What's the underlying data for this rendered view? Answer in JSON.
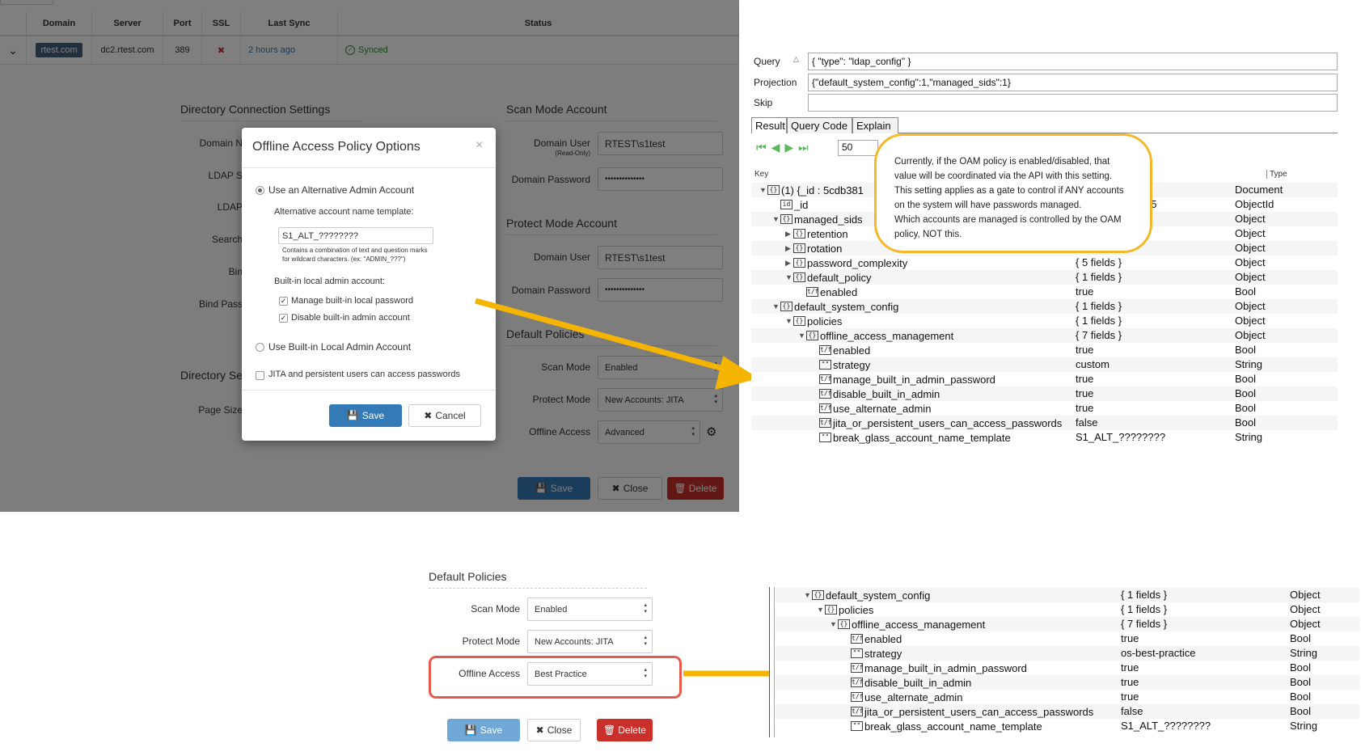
{
  "top_table": {
    "headers": [
      "Domain",
      "Server",
      "Port",
      "SSL",
      "Last Sync",
      "Status"
    ],
    "row": {
      "domain": "rtest.com",
      "server": "dc2.rtest.com",
      "port": "389",
      "ssl": "✖",
      "last_sync": "2 hours ago",
      "status": "Synced"
    }
  },
  "settings": {
    "dir_conn_title": "Directory Connection Settings",
    "scan_mode_title": "Scan Mode Account",
    "protect_mode_title": "Protect Mode Account",
    "default_policies_title": "Default Policies",
    "dir_se_title": "Directory Se",
    "left_labels": [
      "Domain N",
      "LDAP S",
      "LDAP",
      "Search",
      "Bin",
      "Bind Pass"
    ],
    "page_size_label": "Page Size",
    "domain_user_label": "Domain User",
    "read_only_label": "(Read-Only)",
    "domain_password_label": "Domain Password",
    "scan_user": "RTEST\\s1test",
    "password_mask": "••••••••••••••",
    "protect_user": "RTEST\\s1test",
    "scan_mode_label": "Scan Mode",
    "scan_mode_value": "Enabled",
    "protect_mode_label": "Protect Mode",
    "protect_mode_value": "New Accounts: JITA",
    "offline_access_label": "Offline Access",
    "offline_access_value": "Advanced",
    "save": "Save",
    "close": "Close",
    "delete": "Delete"
  },
  "modal": {
    "title": "Offline Access Policy Options",
    "close": "×",
    "opt_alt": "Use an Alternative Admin Account",
    "template_label": "Alternative account name template:",
    "template_value": "S1_ALT_????????",
    "help1": "Contains a combination of text and question marks",
    "help2": "for wildcard characters. (ex: \"ADMIN_???\")",
    "builtin_label": "Built-in local admin account:",
    "manage_pw": "Manage built-in local password",
    "disable_admin": "Disable built-in admin account",
    "opt_builtin": "Use Built-in Local Admin Account",
    "jita": "JITA and persistent users can access passwords",
    "save": "Save",
    "cancel": "Cancel"
  },
  "mongo": {
    "query_label": "Query",
    "query_value": "{ \"type\": \"ldap_config\" }",
    "projection_label": "Projection",
    "projection_value": "{\"default_system_config\":1,\"managed_sids\":1}",
    "skip_label": "Skip",
    "tabs": [
      "Result",
      "Query Code",
      "Explain"
    ],
    "page_size": "50",
    "col_key": "Key",
    "col_type": "Type",
    "rows": [
      {
        "indent": 0,
        "tri": "▼",
        "icon": "{}",
        "key": "(1) {_id : 5cdb381",
        "value": "",
        "type": "Document"
      },
      {
        "indent": 1,
        "tri": "",
        "icon": "id",
        "key": "_id",
        "value": "f71f800583c2135",
        "type": "ObjectId"
      },
      {
        "indent": 1,
        "tri": "▼",
        "icon": "{}",
        "key": "managed_sids",
        "value": "",
        "type": "Object"
      },
      {
        "indent": 2,
        "tri": "▶",
        "icon": "{}",
        "key": "retention",
        "value": "",
        "type": "Object"
      },
      {
        "indent": 2,
        "tri": "▶",
        "icon": "{}",
        "key": "rotation",
        "value": "",
        "type": "Object"
      },
      {
        "indent": 2,
        "tri": "▶",
        "icon": "{}",
        "key": "password_complexity",
        "value": "{ 5 fields }",
        "type": "Object"
      },
      {
        "indent": 2,
        "tri": "▼",
        "icon": "{}",
        "key": "default_policy",
        "value": "{ 1 fields }",
        "type": "Object"
      },
      {
        "indent": 3,
        "tri": "",
        "icon": "t/f",
        "key": "enabled",
        "value": "true",
        "type": "Bool"
      },
      {
        "indent": 1,
        "tri": "▼",
        "icon": "{}",
        "key": "default_system_config",
        "value": "{ 1 fields }",
        "type": "Object"
      },
      {
        "indent": 2,
        "tri": "▼",
        "icon": "{}",
        "key": "policies",
        "value": "{ 1 fields }",
        "type": "Object"
      },
      {
        "indent": 3,
        "tri": "▼",
        "icon": "{}",
        "key": "offline_access_management",
        "value": "{ 7 fields }",
        "type": "Object"
      },
      {
        "indent": 4,
        "tri": "",
        "icon": "t/f",
        "key": "enabled",
        "value": "true",
        "type": "Bool"
      },
      {
        "indent": 4,
        "tri": "",
        "icon": "\"\"",
        "key": "strategy",
        "value": "custom",
        "type": "String"
      },
      {
        "indent": 4,
        "tri": "",
        "icon": "t/f",
        "key": "manage_built_in_admin_password",
        "value": "true",
        "type": "Bool"
      },
      {
        "indent": 4,
        "tri": "",
        "icon": "t/f",
        "key": "disable_built_in_admin",
        "value": "true",
        "type": "Bool"
      },
      {
        "indent": 4,
        "tri": "",
        "icon": "t/f",
        "key": "use_alternate_admin",
        "value": "true",
        "type": "Bool"
      },
      {
        "indent": 4,
        "tri": "",
        "icon": "t/f",
        "key": "jita_or_persistent_users_can_access_passwords",
        "value": "false",
        "type": "Bool"
      },
      {
        "indent": 4,
        "tri": "",
        "icon": "\"\"",
        "key": "break_glass_account_name_template",
        "value": "S1_ALT_????????",
        "type": "String"
      }
    ]
  },
  "callout": {
    "lines": [
      "Currently, if the OAM policy is enabled/disabled, that",
      "value will be coordinated via the API with this setting.",
      "This setting applies as a gate to control if ANY accounts",
      "on the system will have passwords managed.",
      "Which accounts are managed is controlled by the OAM",
      "policy, NOT this."
    ]
  },
  "bottom_form": {
    "title": "Default Policies",
    "scan_mode_label": "Scan Mode",
    "scan_mode_value": "Enabled",
    "protect_mode_label": "Protect Mode",
    "protect_mode_value": "New Accounts: JITA",
    "offline_access_label": "Offline Access",
    "offline_access_value": "Best Practice",
    "save": "Save",
    "close": "Close",
    "delete": "Delete"
  },
  "bottom_tree": {
    "rows": [
      {
        "indent": 0,
        "tri": "▼",
        "icon": "{}",
        "key": "default_system_config",
        "value": "{ 1 fields }",
        "type": "Object"
      },
      {
        "indent": 1,
        "tri": "▼",
        "icon": "{}",
        "key": "policies",
        "value": "{ 1 fields }",
        "type": "Object"
      },
      {
        "indent": 2,
        "tri": "▼",
        "icon": "{}",
        "key": "offline_access_management",
        "value": "{ 7 fields }",
        "type": "Object"
      },
      {
        "indent": 3,
        "tri": "",
        "icon": "t/f",
        "key": "enabled",
        "value": "true",
        "type": "Bool"
      },
      {
        "indent": 3,
        "tri": "",
        "icon": "\"\"",
        "key": "strategy",
        "value": "os-best-practice",
        "type": "String"
      },
      {
        "indent": 3,
        "tri": "",
        "icon": "t/f",
        "key": "manage_built_in_admin_password",
        "value": "true",
        "type": "Bool"
      },
      {
        "indent": 3,
        "tri": "",
        "icon": "t/f",
        "key": "disable_built_in_admin",
        "value": "true",
        "type": "Bool"
      },
      {
        "indent": 3,
        "tri": "",
        "icon": "t/f",
        "key": "use_alternate_admin",
        "value": "true",
        "type": "Bool"
      },
      {
        "indent": 3,
        "tri": "",
        "icon": "t/f",
        "key": "jita_or_persistent_users_can_access_passwords",
        "value": "false",
        "type": "Bool"
      },
      {
        "indent": 3,
        "tri": "",
        "icon": "\"\"",
        "key": "break_glass_account_name_template",
        "value": "S1_ALT_????????",
        "type": "String"
      }
    ]
  },
  "colors": {
    "accent": "#337ab7",
    "delete": "#c9302c",
    "highlight": "#f4b400",
    "callout_border": "#f6b82a",
    "red_box": "#e8594d",
    "synced": "#2e8b2e",
    "ssl_x": "#c9302c"
  }
}
